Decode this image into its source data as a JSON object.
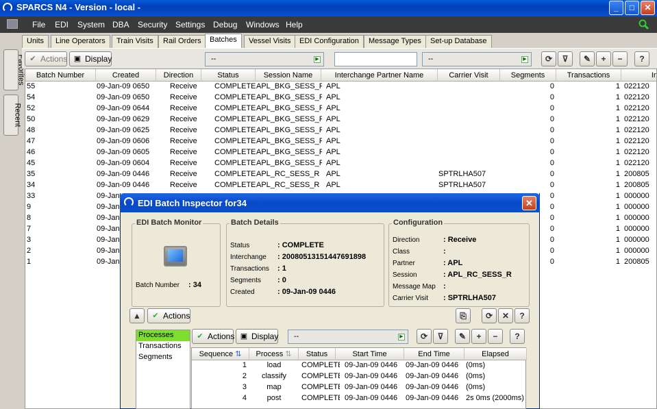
{
  "window": {
    "title": "SPARCS N4 - Version - local -",
    "btn_min": "_",
    "btn_max": "□",
    "btn_close": "✕"
  },
  "menu": [
    "File",
    "EDI",
    "System",
    "DBA",
    "Security",
    "Settings",
    "Debug",
    "Windows",
    "Help"
  ],
  "side_tabs": [
    "Favorites",
    "Recent"
  ],
  "tabs": [
    "Units",
    "Line Operators",
    "Train Visits",
    "Rail Orders",
    "Batches",
    "Vessel Visits",
    "EDI Configuration",
    "Message Types",
    "Set-up Database"
  ],
  "active_tab": "Batches",
  "toolbar": {
    "actions": "Actions",
    "display": "Display",
    "combo1": "--",
    "combo2": "--"
  },
  "grid": {
    "columns": [
      "Batch Number",
      "Created",
      "Direction",
      "Status",
      "Session Name",
      "Interchange Partner Name",
      "Carrier Visit",
      "Segments",
      "Transactions",
      "In"
    ],
    "rows": [
      [
        "55",
        "09-Jan-09 0650",
        "Receive",
        "COMPLETE",
        "APL_BKG_SESS_R",
        "APL",
        "",
        "0",
        "1",
        "022120"
      ],
      [
        "54",
        "09-Jan-09 0650",
        "Receive",
        "COMPLETE",
        "APL_BKG_SESS_R",
        "APL",
        "",
        "0",
        "1",
        "022120"
      ],
      [
        "52",
        "09-Jan-09 0644",
        "Receive",
        "COMPLETE",
        "APL_BKG_SESS_R",
        "APL",
        "",
        "0",
        "1",
        "022120"
      ],
      [
        "50",
        "09-Jan-09 0629",
        "Receive",
        "COMPLETE",
        "APL_BKG_SESS_R",
        "APL",
        "",
        "0",
        "1",
        "022120"
      ],
      [
        "48",
        "09-Jan-09 0625",
        "Receive",
        "COMPLETE",
        "APL_BKG_SESS_R",
        "APL",
        "",
        "0",
        "1",
        "022120"
      ],
      [
        "47",
        "09-Jan-09 0606",
        "Receive",
        "COMPLETE",
        "APL_BKG_SESS_R",
        "APL",
        "",
        "0",
        "1",
        "022120"
      ],
      [
        "46",
        "09-Jan-09 0605",
        "Receive",
        "COMPLETE",
        "APL_BKG_SESS_R",
        "APL",
        "",
        "0",
        "1",
        "022120"
      ],
      [
        "45",
        "09-Jan-09 0604",
        "Receive",
        "COMPLETE",
        "APL_BKG_SESS_R",
        "APL",
        "",
        "0",
        "1",
        "022120"
      ],
      [
        "35",
        "09-Jan-09 0446",
        "Receive",
        "COMPLETE",
        "APL_RC_SESS_R",
        "APL",
        "SPTRLHA507",
        "0",
        "1",
        "200805"
      ],
      [
        "34",
        "09-Jan-09 0446",
        "Receive",
        "COMPLETE",
        "APL_RC_SESS_R",
        "APL",
        "SPTRLHA507",
        "0",
        "1",
        "200805"
      ],
      [
        "33",
        "09-Jan-",
        "",
        "",
        "",
        "",
        "",
        "0",
        "1",
        "000000"
      ],
      [
        "9",
        "09-Jan-",
        "",
        "",
        "",
        "",
        "",
        "0",
        "1",
        "000000"
      ],
      [
        "8",
        "09-Jan-",
        "",
        "",
        "",
        "",
        "",
        "0",
        "1",
        "000000"
      ],
      [
        "7",
        "09-Jan-",
        "",
        "",
        "",
        "",
        "",
        "0",
        "1",
        "000000"
      ],
      [
        "3",
        "09-Jan-",
        "",
        "",
        "",
        "",
        "",
        "0",
        "1",
        "000000"
      ],
      [
        "2",
        "09-Jan-",
        "",
        "",
        "",
        "",
        "",
        "0",
        "1",
        "000000"
      ],
      [
        "1",
        "09-Jan-",
        "",
        "",
        "",
        "",
        "",
        "0",
        "1",
        "200805"
      ]
    ]
  },
  "dialog": {
    "title": "EDI Batch Inspector for34",
    "monitor": {
      "label": "EDI Batch Monitor",
      "batch_label": "Batch Number",
      "batch_value": ": 34"
    },
    "details": {
      "label": "Batch Details",
      "items": [
        {
          "k": "Status",
          "v": ": COMPLETE"
        },
        {
          "k": "Interchange",
          "v": ": 20080513151447691898"
        },
        {
          "k": "Transactions",
          "v": ": 1"
        },
        {
          "k": "Segments",
          "v": ": 0"
        },
        {
          "k": "Created",
          "v": ": 09-Jan-09 0446"
        }
      ]
    },
    "config": {
      "label": "Configuration",
      "items": [
        {
          "k": "Direction",
          "v": ": Receive"
        },
        {
          "k": "Class",
          "v": ":"
        },
        {
          "k": "Partner",
          "v": ": APL"
        },
        {
          "k": "Session",
          "v": ": APL_RC_SESS_R"
        },
        {
          "k": "Message Map",
          "v": ":"
        },
        {
          "k": "Carrier Visit",
          "v": ": SPTRLHA507"
        }
      ]
    },
    "actions": "Actions",
    "left_list": [
      "Processes",
      "Transactions",
      "Segments"
    ],
    "sub_toolbar": {
      "actions": "Actions",
      "display": "Display",
      "combo": "--"
    },
    "sub_grid": {
      "columns": [
        "Sequence",
        "Process",
        "Status",
        "Start Time",
        "End Time",
        "Elapsed"
      ],
      "rows": [
        [
          "1",
          "load",
          "COMPLETE",
          "09-Jan-09 0446",
          "09-Jan-09 0446",
          "(0ms)"
        ],
        [
          "2",
          "classify",
          "COMPLETE",
          "09-Jan-09 0446",
          "09-Jan-09 0446",
          "(0ms)"
        ],
        [
          "3",
          "map",
          "COMPLETE",
          "09-Jan-09 0446",
          "09-Jan-09 0446",
          "(0ms)"
        ],
        [
          "4",
          "post",
          "COMPLETE",
          "09-Jan-09 0446",
          "09-Jan-09 0446",
          "2s 0ms (2000ms)"
        ]
      ]
    }
  }
}
